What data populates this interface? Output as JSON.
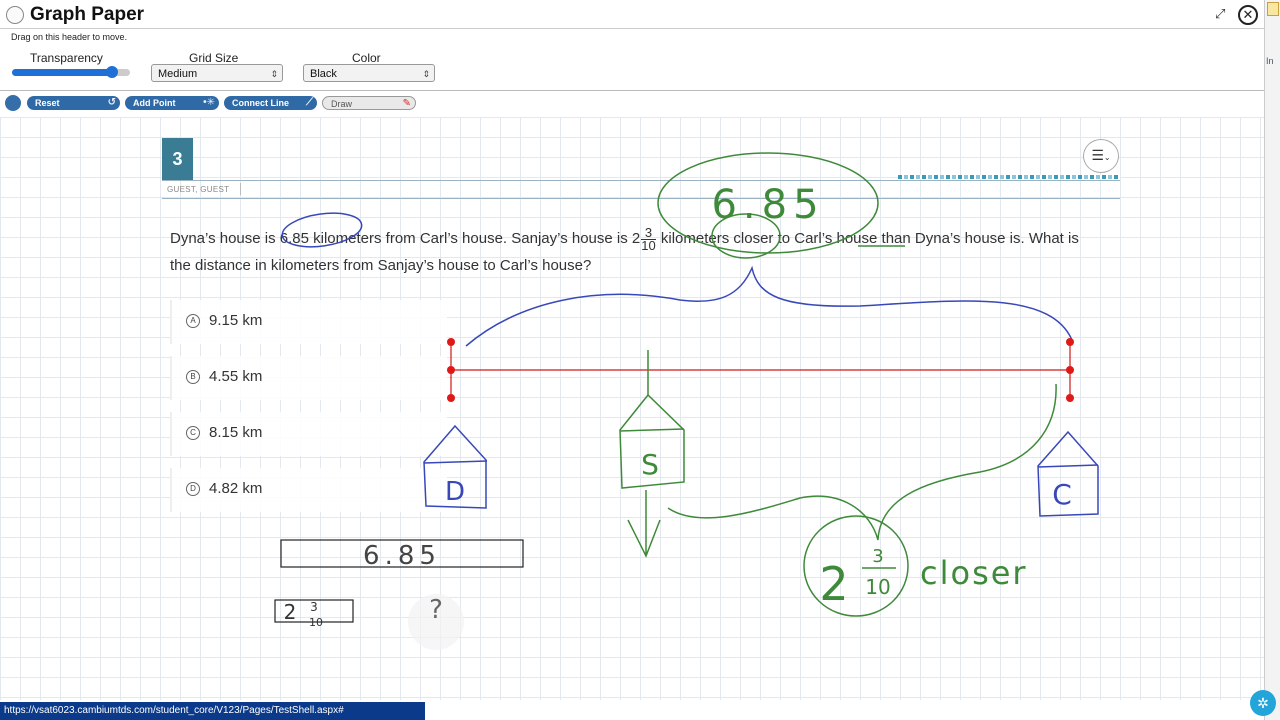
{
  "window": {
    "title": "Graph Paper",
    "drag_hint": "Drag on this header to move."
  },
  "controls": {
    "transparency_label": "Transparency",
    "transparency_value": 0.85,
    "grid_size_label": "Grid Size",
    "grid_size_value": "Medium",
    "color_label": "Color",
    "color_value": "Black"
  },
  "toolbar": {
    "reset": "Reset",
    "add_point": "Add Point",
    "connect_line": "Connect Line",
    "draw": "Draw"
  },
  "question": {
    "number": "3",
    "user": "GUEST, GUEST",
    "text_part1": "Dyna’s house is 6.85 kilometers from Carl’s house. Sanjay’s house is ",
    "mixed_whole": "2",
    "mixed_num": "3",
    "mixed_den": "10",
    "text_part2": " kilometers closer to Carl’s house than Dyna’s house is. What is the distance in kilometers from Sanjay’s house to Carl’s house?"
  },
  "answers": [
    {
      "letter": "A",
      "text": "9.15 km"
    },
    {
      "letter": "B",
      "text": "4.55 km"
    },
    {
      "letter": "C",
      "text": "8.15 km"
    },
    {
      "letter": "D",
      "text": "4.82 km"
    }
  ],
  "annotations": {
    "top_value": "6.85",
    "tape_value": "6.85",
    "house_d": "D",
    "house_s": "S",
    "house_c": "C",
    "closer_whole": "2",
    "closer_num": "3",
    "closer_den": "10",
    "closer_word": "closer",
    "small_whole": "2",
    "small_num": "3",
    "small_den": "10",
    "question_mark": "?"
  },
  "colors": {
    "green_ink": "#3f8a3a",
    "blue_ink": "#3848b8",
    "red_line": "#d01818",
    "accent": "#3a7c93"
  },
  "status_url": "https://vsat6023.cambiumtds.com/student_core/V123/Pages/TestShell.aspx#"
}
